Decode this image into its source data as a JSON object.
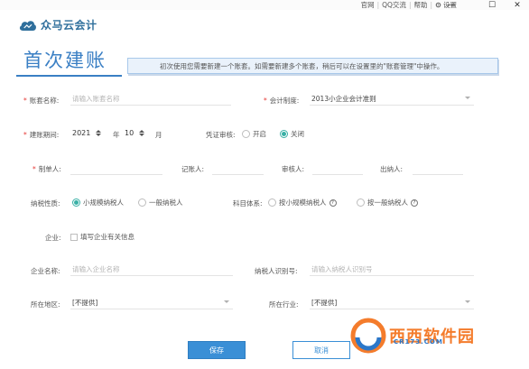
{
  "titlebar": {
    "links": [
      "官网",
      "QQ交流",
      "帮助",
      "设置"
    ],
    "minimize": "—",
    "maximize": "☐",
    "close": "✕"
  },
  "logo": {
    "text": "众马云会计"
  },
  "page": {
    "title": "首次建账",
    "notice": "初次使用您需要新建一个账套。如需要新建多个账套，稍后可以在设置里的\"账套管理\"中操作。"
  },
  "form": {
    "account_name": {
      "label": "账套名称:",
      "placeholder": "请输入账套名称"
    },
    "accounting_system": {
      "label": "会计制度:",
      "value": "2013小企业会计准则"
    },
    "period": {
      "label": "建账期间:",
      "year": "2021",
      "year_unit": "年",
      "month": "10",
      "month_unit": "月"
    },
    "voucher_review": {
      "label": "凭证审核:",
      "options": [
        "开启",
        "关闭"
      ],
      "selected": "关闭"
    },
    "preparer": {
      "label": "制单人:"
    },
    "bookkeeper": {
      "label": "记账人:"
    },
    "reviewer": {
      "label": "审核人:"
    },
    "cashier": {
      "label": "出纳人:"
    },
    "taxpayer_type": {
      "label": "纳税性质:",
      "options": [
        "小规模纳税人",
        "一般纳税人"
      ],
      "selected": "小规模纳税人"
    },
    "subject_system": {
      "label": "科目体系:",
      "options": [
        "按小规模纳税人",
        "按一般纳税人"
      ],
      "help_icon": "?"
    },
    "enterprise": {
      "label": "企业:",
      "checkbox_label": "填写企业有关信息"
    },
    "company_name": {
      "label": "企业名称:",
      "placeholder": "请输入企业名称"
    },
    "taxpayer_id": {
      "label": "纳税人识别号:",
      "placeholder": "请输入纳税人识别号"
    },
    "region": {
      "label": "所在地区:",
      "value": "[不提供]"
    },
    "industry": {
      "label": "所在行业:",
      "value": "[不提供]"
    }
  },
  "buttons": {
    "save": "保存",
    "cancel": "取消"
  },
  "watermark": {
    "text": "西西软件园",
    "url": "CR173.COM"
  },
  "colors": {
    "accent": "#3a8fd6",
    "title": "#3a7fc4",
    "required": "#e53935",
    "radio_on": "#3ab0a6"
  }
}
